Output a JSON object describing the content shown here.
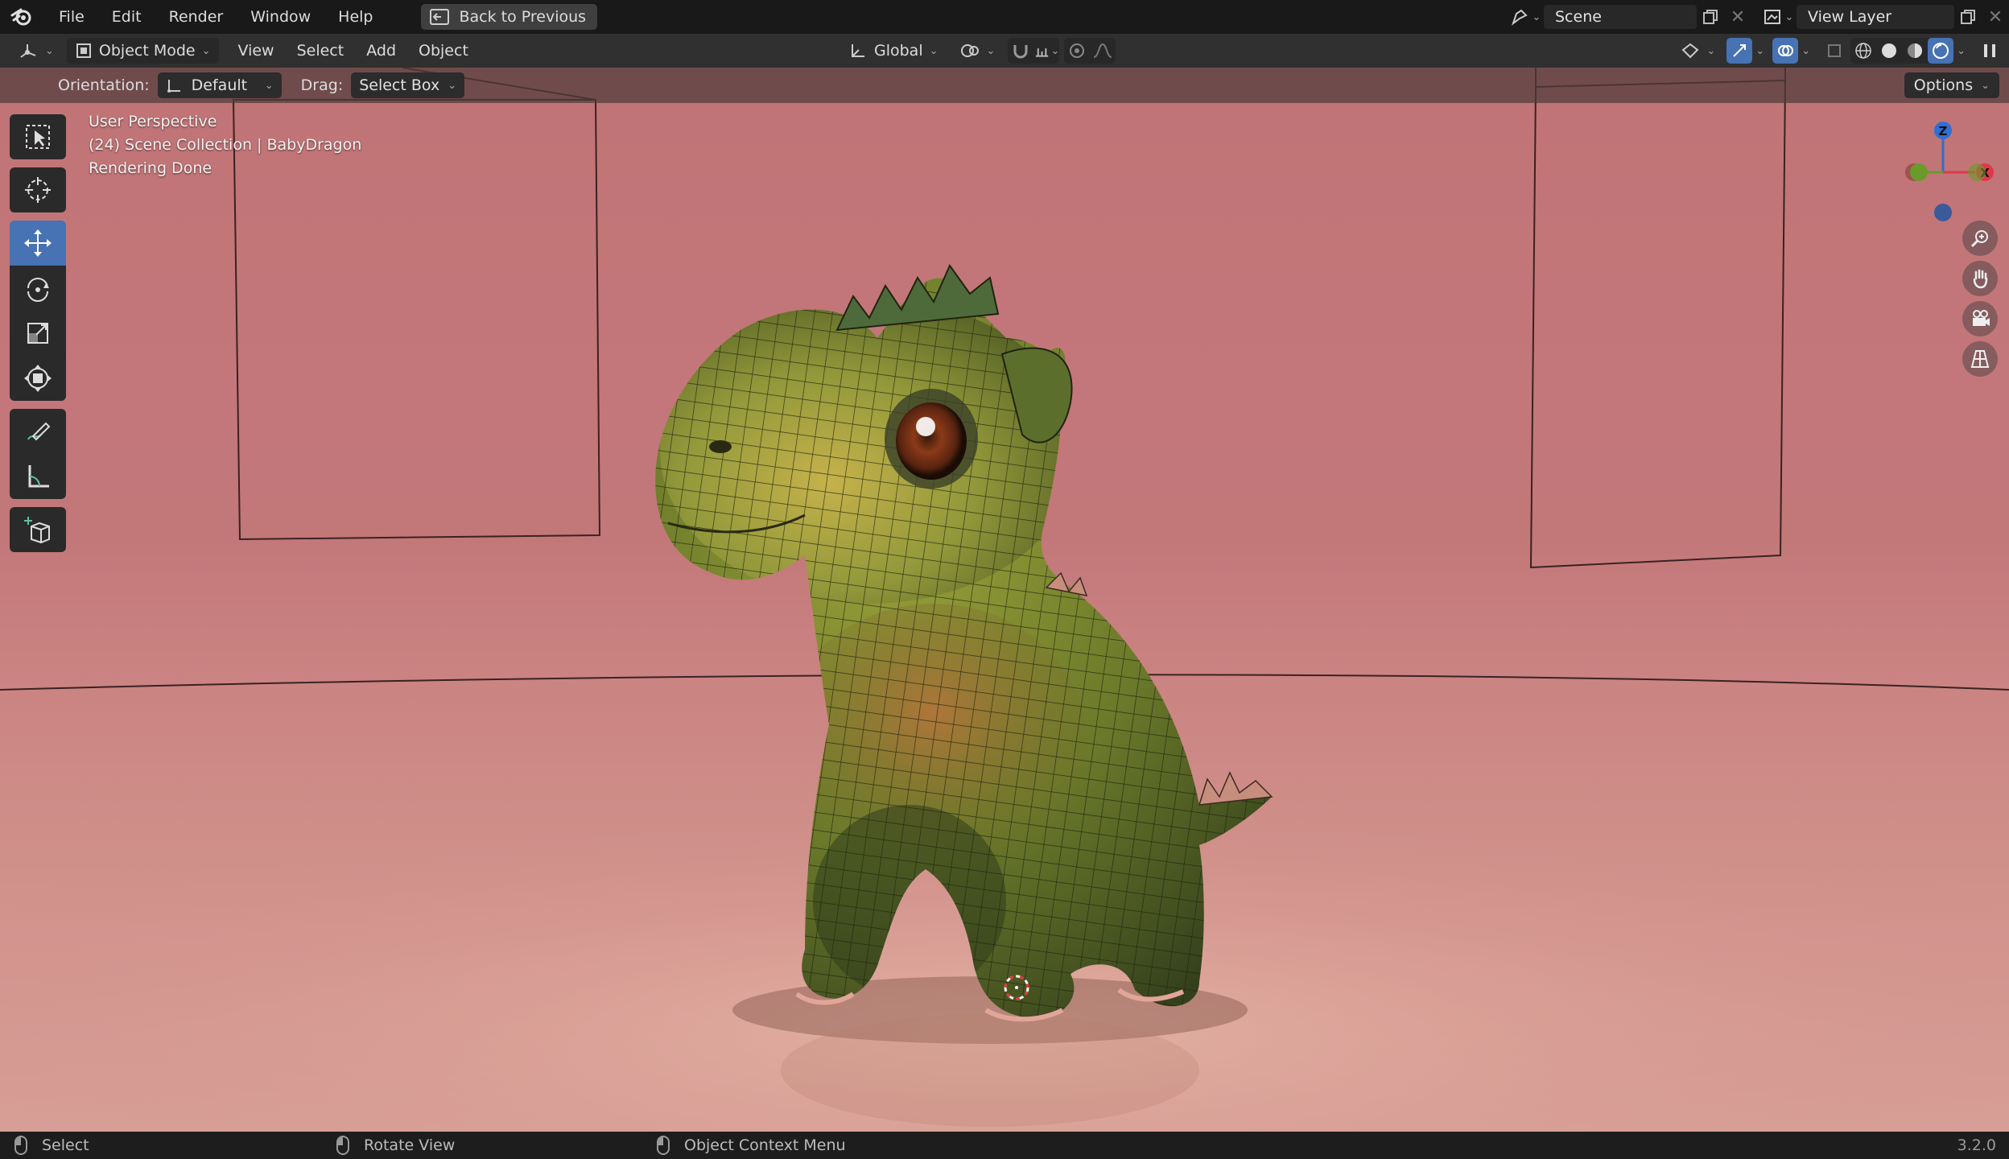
{
  "app": {
    "name": "Blender",
    "version": "3.2.0"
  },
  "topbar": {
    "menus": [
      "File",
      "Edit",
      "Render",
      "Window",
      "Help"
    ],
    "back_button": "Back to Previous",
    "scene": "Scene",
    "view_layer": "View Layer"
  },
  "header": {
    "mode": "Object Mode",
    "menus": [
      "View",
      "Select",
      "Add",
      "Object"
    ],
    "transform_orientation": "Global"
  },
  "tool_settings": {
    "orientation_label": "Orientation:",
    "orientation_value": "Default",
    "drag_label": "Drag:",
    "drag_value": "Select Box",
    "options": "Options"
  },
  "viewport": {
    "perspective": "User Perspective",
    "collection": "(24) Scene Collection | BabyDragon",
    "status": "Rendering Done",
    "background_color": "#c27779",
    "gizmo": {
      "z": "Z",
      "x": "X",
      "z_color": "#2f6fd6",
      "x_color": "#e0384a",
      "y_color": "#6a9a2a"
    }
  },
  "toolbar": {
    "tools": [
      "select-box",
      "cursor",
      "move",
      "rotate",
      "scale",
      "transform",
      "annotate",
      "measure",
      "add-cube"
    ],
    "active": "move",
    "accent": "#4772b3"
  },
  "statusbar": {
    "left": "Select",
    "middle": "Rotate View",
    "right": "Object Context Menu"
  }
}
